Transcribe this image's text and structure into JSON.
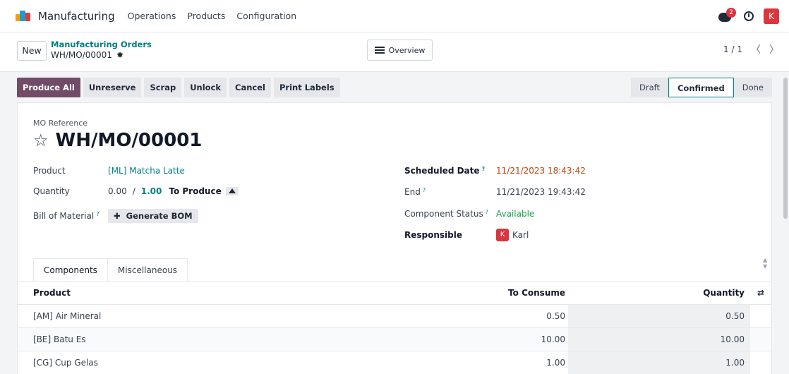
{
  "navbar": {
    "app_name": "Manufacturing",
    "menu": [
      "Operations",
      "Products",
      "Configuration"
    ],
    "chat_badge": "2",
    "user_initial": "K"
  },
  "control": {
    "new_label": "New",
    "breadcrumb_parent": "Manufacturing Orders",
    "breadcrumb_current": "WH/MO/00001",
    "overview_label": "Overview",
    "pager": "1 / 1"
  },
  "actions": {
    "produce_all": "Produce All",
    "unreserve": "Unreserve",
    "scrap": "Scrap",
    "unlock": "Unlock",
    "cancel": "Cancel",
    "print_labels": "Print Labels"
  },
  "status": {
    "draft": "Draft",
    "confirmed": "Confirmed",
    "done": "Done"
  },
  "form": {
    "mo_ref_label": "MO Reference",
    "title": "WH/MO/00001",
    "product_label": "Product",
    "product_value": "[ML] Matcha Latte",
    "quantity_label": "Quantity",
    "quantity_produced": "0.00",
    "quantity_sep": "/",
    "quantity_total": "1.00",
    "to_produce_label": "To Produce",
    "bom_label": "Bill of Material",
    "generate_bom_label": "Generate BOM",
    "scheduled_label": "Scheduled Date",
    "scheduled_value": "11/21/2023 18:43:42",
    "end_label": "End",
    "end_value": "11/21/2023 19:43:42",
    "component_status_label": "Component Status",
    "component_status_value": "Available",
    "responsible_label": "Responsible",
    "responsible_initial": "K",
    "responsible_name": "Karl",
    "help_mark": "?"
  },
  "tabs": [
    "Components",
    "Miscellaneous"
  ],
  "table": {
    "headers": {
      "product": "Product",
      "to_consume": "To Consume",
      "quantity": "Quantity"
    },
    "rows": [
      {
        "product": "[AM] Air Mineral",
        "to_consume": "0.50",
        "quantity": "0.50"
      },
      {
        "product": "[BE] Batu Es",
        "to_consume": "10.00",
        "quantity": "10.00"
      },
      {
        "product": "[CG] Cup Gelas",
        "to_consume": "1.00",
        "quantity": "1.00"
      }
    ]
  },
  "colors": {
    "primary": "#714b67",
    "link": "#017e84",
    "badge": "#e0313f"
  }
}
